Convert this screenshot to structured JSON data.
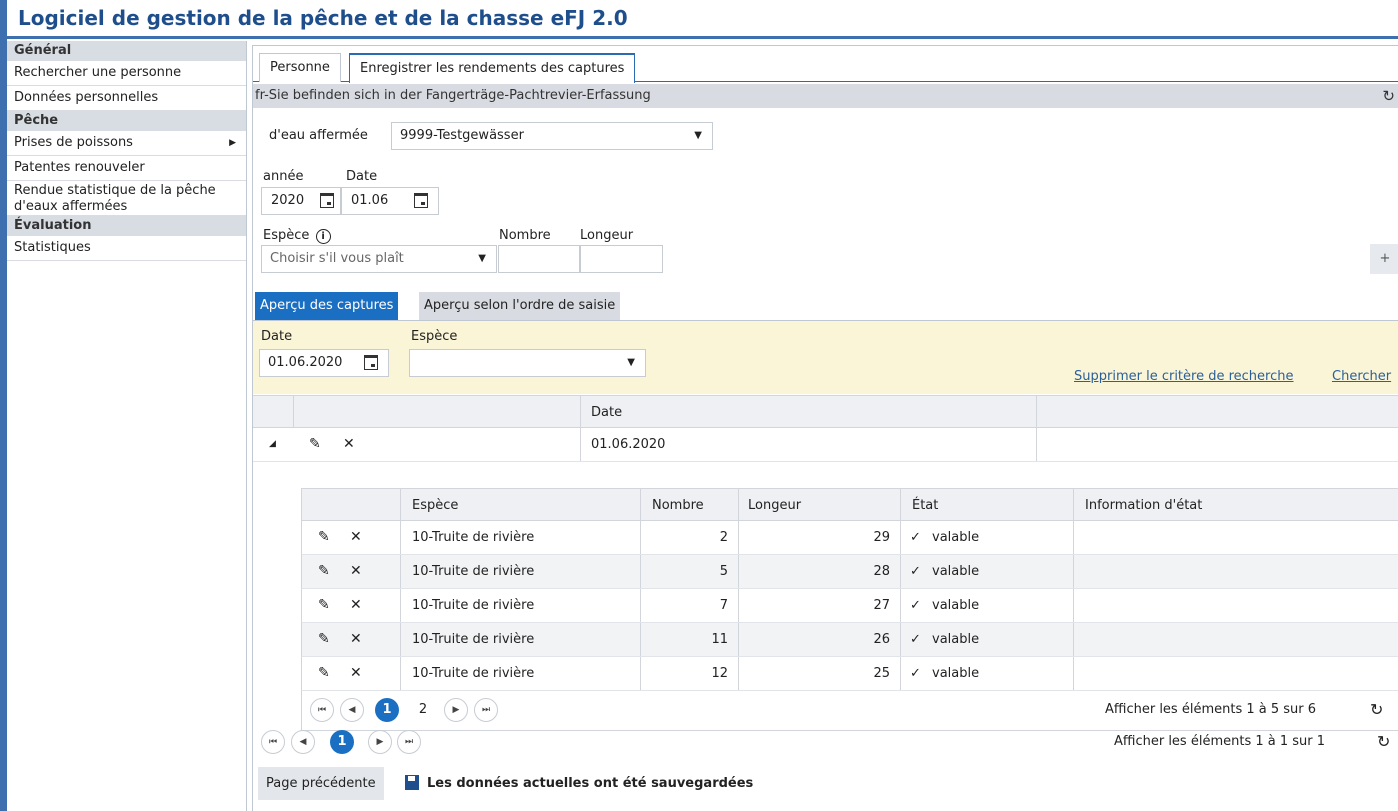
{
  "app_title": "Logiciel de gestion de la pêche et de la chasse eFJ 2.0",
  "sidebar": {
    "sections": [
      {
        "title": "Général",
        "items": [
          "Rechercher une personne",
          "Données personnelles"
        ]
      },
      {
        "title": "Pêche",
        "items": [
          "Prises de poissons",
          "Patentes renouveler",
          "Rendue statistique de la pêche d'eaux affermées"
        ]
      },
      {
        "title": "Évaluation",
        "items": [
          "Statistiques"
        ]
      }
    ]
  },
  "tabs": [
    "Personne",
    "Enregistrer les rendements des captures"
  ],
  "info_bar": "fr-Sie befinden sich in der Fangerträge-Pachtrevier-Erfassung",
  "form": {
    "water_label": "d'eau affermée",
    "water_value": "9999-Testgewässer",
    "year_label": "année",
    "year_value": "2020",
    "date_label": "Date",
    "date_value": "01.06",
    "species_label": "Espèce",
    "species_placeholder": "Choisir s'il vous plaît",
    "count_label": "Nombre",
    "length_label": "Longeur",
    "add_symbol": "+"
  },
  "subtabs": [
    "Aperçu des captures",
    "Aperçu selon l'ordre de saisie"
  ],
  "filter": {
    "date_label": "Date",
    "date_value": "01.06.2020",
    "species_label": "Espèce",
    "clear_link": "Supprimer le critère de recherche",
    "search_link": "Chercher"
  },
  "outer_grid": {
    "header": "Date",
    "row_date": "01.06.2020"
  },
  "inner_grid": {
    "headers": [
      "Espèce",
      "Nombre",
      "Longeur",
      "État",
      "Information d'état"
    ],
    "rows": [
      {
        "species": "10-Truite de rivière",
        "count": "2",
        "length": "29",
        "state": "valable"
      },
      {
        "species": "10-Truite de rivière",
        "count": "5",
        "length": "28",
        "state": "valable"
      },
      {
        "species": "10-Truite de rivière",
        "count": "7",
        "length": "27",
        "state": "valable"
      },
      {
        "species": "10-Truite de rivière",
        "count": "11",
        "length": "26",
        "state": "valable"
      },
      {
        "species": "10-Truite de rivière",
        "count": "12",
        "length": "25",
        "state": "valable"
      }
    ],
    "pages": [
      "1",
      "2"
    ],
    "pager_info": "Afficher les éléments 1 à 5 sur 6"
  },
  "outer_pager": {
    "pages": [
      "1"
    ],
    "pager_info": "Afficher les éléments 1 à 1 sur 1"
  },
  "back_button": "Page précédente",
  "save_message": "Les données actuelles ont été sauvegardées"
}
